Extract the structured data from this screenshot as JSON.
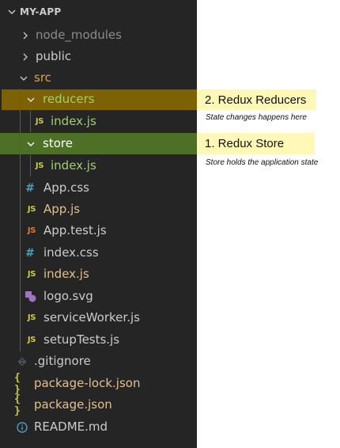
{
  "explorer": {
    "title": "MY-APP",
    "items": [
      {
        "label": "node_modules",
        "icon": "chevron-right-icon",
        "color": "#8c8c8c"
      },
      {
        "label": "public",
        "icon": "chevron-right-icon",
        "color": "#cccccc"
      },
      {
        "label": "src",
        "icon": "chevron-down-icon",
        "color": "#d9a24a"
      },
      {
        "label": "reducers",
        "icon": "chevron-down-icon",
        "color": "#9fd06a"
      },
      {
        "label": "index.js",
        "icon": "js-file-icon",
        "badge": "JS",
        "color": "#9fd06a"
      },
      {
        "label": "store",
        "icon": "chevron-down-icon",
        "color": "#ffffff"
      },
      {
        "label": "index.js",
        "icon": "js-file-icon",
        "badge": "JS",
        "color": "#9fd06a"
      },
      {
        "label": "App.css",
        "icon": "css-file-icon",
        "badge": "#",
        "color": "#cccccc"
      },
      {
        "label": "App.js",
        "icon": "js-file-icon",
        "badge": "JS",
        "color": "#e2c08d"
      },
      {
        "label": "App.test.js",
        "icon": "test-js-file-icon",
        "badge": "JS",
        "color": "#cccccc"
      },
      {
        "label": "index.css",
        "icon": "css-file-icon",
        "badge": "#",
        "color": "#cccccc"
      },
      {
        "label": "index.js",
        "icon": "js-file-icon",
        "badge": "JS",
        "color": "#e2c08d"
      },
      {
        "label": "logo.svg",
        "icon": "svg-file-icon",
        "color": "#cccccc"
      },
      {
        "label": "serviceWorker.js",
        "icon": "js-file-icon",
        "badge": "JS",
        "color": "#cccccc"
      },
      {
        "label": "setupTests.js",
        "icon": "js-file-icon",
        "badge": "JS",
        "color": "#cccccc"
      },
      {
        "label": ".gitignore",
        "icon": "git-file-icon",
        "color": "#cccccc"
      },
      {
        "label": "package-lock.json",
        "icon": "json-file-icon",
        "badge": "{ }",
        "color": "#e2c08d"
      },
      {
        "label": "package.json",
        "icon": "json-file-icon",
        "badge": "{ }",
        "color": "#e2c08d"
      },
      {
        "label": "README.md",
        "icon": "info-file-icon",
        "color": "#cccccc"
      }
    ]
  },
  "annotations": {
    "reducers": {
      "title": "2. Redux Reducers",
      "note": "State changes happens here"
    },
    "store": {
      "title": "1. Redux Store",
      "note": "Store holds the application state"
    }
  },
  "colors": {
    "sidebar_bg": "#252526",
    "reducers_highlight": "#8d6c00",
    "store_highlight": "#4f7426",
    "annotation_bg": "#fff8b7"
  }
}
